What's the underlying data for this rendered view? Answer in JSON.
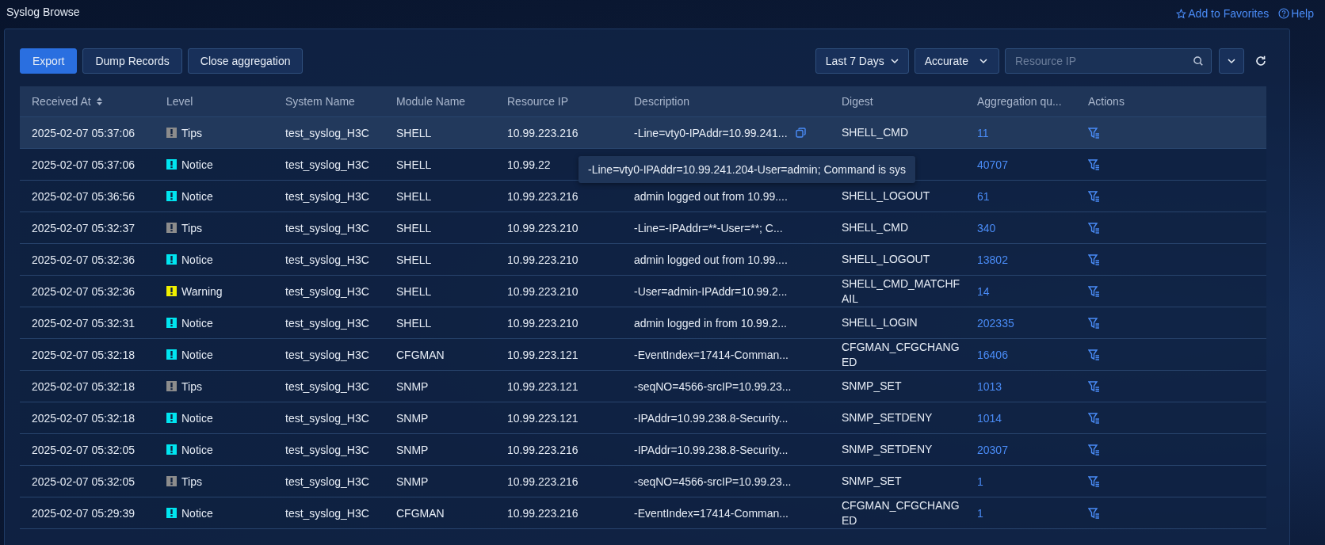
{
  "page": {
    "title": "Syslog Browse",
    "links": [
      {
        "label": "Add to Favorites",
        "kind": "favorite"
      },
      {
        "label": "Help",
        "kind": "help"
      }
    ]
  },
  "toolbar": {
    "buttons": [
      {
        "label": "Export",
        "primary": true
      },
      {
        "label": "Dump Records",
        "primary": false
      },
      {
        "label": "Close aggregation",
        "primary": false
      }
    ],
    "time_range": "Last 7 Days",
    "match_mode": "Accurate",
    "search": {
      "placeholder": "Resource IP"
    }
  },
  "table": {
    "columns": [
      {
        "label": "Received At",
        "sortable": true
      },
      {
        "label": "Level",
        "sortable": false
      },
      {
        "label": "System Name",
        "sortable": false
      },
      {
        "label": "Module Name",
        "sortable": false
      },
      {
        "label": "Resource IP",
        "sortable": false
      },
      {
        "label": "Description",
        "sortable": false
      },
      {
        "label": "Digest",
        "sortable": false
      },
      {
        "label": "Aggregation qu...",
        "sortable": false
      },
      {
        "label": "Actions",
        "sortable": false
      }
    ],
    "rows": [
      {
        "received": "2025-02-07 05:37:06",
        "level": "Tips",
        "color": "#8c8c8c",
        "system": "test_syslog_H3C",
        "module": "SHELL",
        "ip": "10.99.223.216",
        "description": "-Line=vty0-IPAddr=10.99.241...",
        "digest": "SHELL_CMD",
        "count": "11",
        "highlighted": true
      },
      {
        "received": "2025-02-07 05:37:06",
        "level": "Notice",
        "color": "#00e5f0",
        "system": "test_syslog_H3C",
        "module": "SHELL",
        "ip": "10.99.22",
        "count": "40707",
        "highlighted": false
      },
      {
        "received": "2025-02-07 05:36:56",
        "level": "Notice",
        "color": "#00e5f0",
        "system": "test_syslog_H3C",
        "module": "SHELL",
        "ip": "10.99.223.216",
        "description": "admin logged out from 10.99....",
        "digest": "SHELL_LOGOUT",
        "count": "61",
        "highlighted": false
      },
      {
        "received": "2025-02-07 05:32:37",
        "level": "Tips",
        "color": "#8c8c8c",
        "system": "test_syslog_H3C",
        "module": "SHELL",
        "ip": "10.99.223.210",
        "description": "-Line=-IPAddr=**-User=**; C...",
        "digest": "SHELL_CMD",
        "count": "340",
        "highlighted": false
      },
      {
        "received": "2025-02-07 05:32:36",
        "level": "Notice",
        "color": "#00e5f0",
        "system": "test_syslog_H3C",
        "module": "SHELL",
        "ip": "10.99.223.210",
        "description": "admin logged out from 10.99....",
        "digest": "SHELL_LOGOUT",
        "count": "13802",
        "highlighted": false
      },
      {
        "received": "2025-02-07 05:32:36",
        "level": "Warning",
        "color": "#f0f000",
        "system": "test_syslog_H3C",
        "module": "SHELL",
        "ip": "10.99.223.210",
        "description": "-User=admin-IPAddr=10.99.2...",
        "digest": "SHELL_CMD_MATCHFAIL",
        "count": "14",
        "highlighted": false
      },
      {
        "received": "2025-02-07 05:32:31",
        "level": "Notice",
        "color": "#00e5f0",
        "system": "test_syslog_H3C",
        "module": "SHELL",
        "ip": "10.99.223.210",
        "description": "admin logged in from 10.99.2...",
        "digest": "SHELL_LOGIN",
        "count": "202335",
        "highlighted": false
      },
      {
        "received": "2025-02-07 05:32:18",
        "level": "Notice",
        "color": "#00e5f0",
        "system": "test_syslog_H3C",
        "module": "CFGMAN",
        "ip": "10.99.223.121",
        "description": "-EventIndex=17414-Comman...",
        "digest": "CFGMAN_CFGCHANGED",
        "count": "16406",
        "highlighted": false
      },
      {
        "received": "2025-02-07 05:32:18",
        "level": "Tips",
        "color": "#8c8c8c",
        "system": "test_syslog_H3C",
        "module": "SNMP",
        "ip": "10.99.223.121",
        "description": "-seqNO=4566-srcIP=10.99.23...",
        "digest": "SNMP_SET",
        "count": "1013",
        "highlighted": false
      },
      {
        "received": "2025-02-07 05:32:18",
        "level": "Notice",
        "color": "#00e5f0",
        "system": "test_syslog_H3C",
        "module": "SNMP",
        "ip": "10.99.223.121",
        "description": "-IPAddr=10.99.238.8-Security...",
        "digest": "SNMP_SETDENY",
        "count": "1014",
        "highlighted": false
      },
      {
        "received": "2025-02-07 05:32:05",
        "level": "Notice",
        "color": "#00e5f0",
        "system": "test_syslog_H3C",
        "module": "SNMP",
        "ip": "10.99.223.216",
        "description": "-IPAddr=10.99.238.8-Security...",
        "digest": "SNMP_SETDENY",
        "count": "20307",
        "highlighted": false
      },
      {
        "received": "2025-02-07 05:32:05",
        "level": "Tips",
        "color": "#8c8c8c",
        "system": "test_syslog_H3C",
        "module": "SNMP",
        "ip": "10.99.223.216",
        "description": "-seqNO=4566-srcIP=10.99.23...",
        "digest": "SNMP_SET",
        "count": "1",
        "highlighted": false
      },
      {
        "received": "2025-02-07 05:29:39",
        "level": "Notice",
        "color": "#00e5f0",
        "system": "test_syslog_H3C",
        "module": "CFGMAN",
        "ip": "10.99.223.216",
        "description": "-EventIndex=17414-Comman...",
        "digest": "CFGMAN_CFGCHANGED",
        "count": "1",
        "highlighted": false
      }
    ],
    "tooltip": "-Line=vty0-IPAddr=10.99.241.204-User=admin; Command is sys"
  }
}
